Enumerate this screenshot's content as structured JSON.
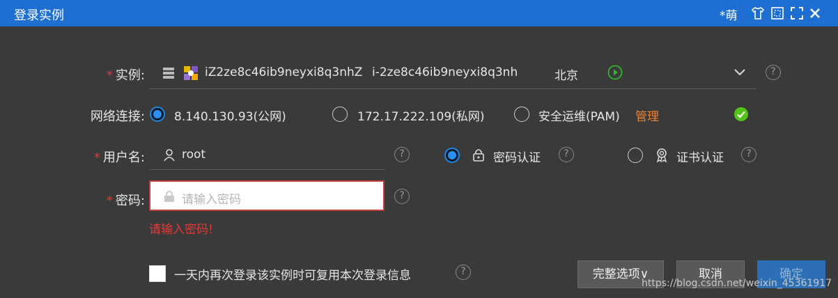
{
  "window": {
    "title": "登录实例",
    "user": "*萌"
  },
  "instance": {
    "label": "实例:",
    "id": "iZ2ze8c46ib9neyxi8q3nhZ",
    "instance_id": "i-2ze8c46ib9neyxi8q3nh",
    "region": "北京"
  },
  "network": {
    "label": "网络连接:",
    "options": [
      "8.140.130.93(公网)",
      "172.17.222.109(私网)",
      "安全运维(PAM)"
    ],
    "manage_link": "管理"
  },
  "username": {
    "label": "用户名:",
    "value": "root"
  },
  "auth": {
    "password_label": "密码认证",
    "cert_label": "证书认证"
  },
  "password": {
    "label": "密码:",
    "placeholder": "请输入密码",
    "error": "请输入密码!"
  },
  "remember": {
    "label": "一天内再次登录该实例时可复用本次登录信息"
  },
  "buttons": {
    "options": "完整选项∨",
    "cancel": "取消",
    "confirm": "确定"
  },
  "watermark": "https://blog.csdn.net/weixin_45361917",
  "colors": {
    "titlebar": "#1e6fd1",
    "accent": "#2c8ff0",
    "error": "#e53935",
    "link": "#e8833a",
    "ok": "#52c41a"
  }
}
